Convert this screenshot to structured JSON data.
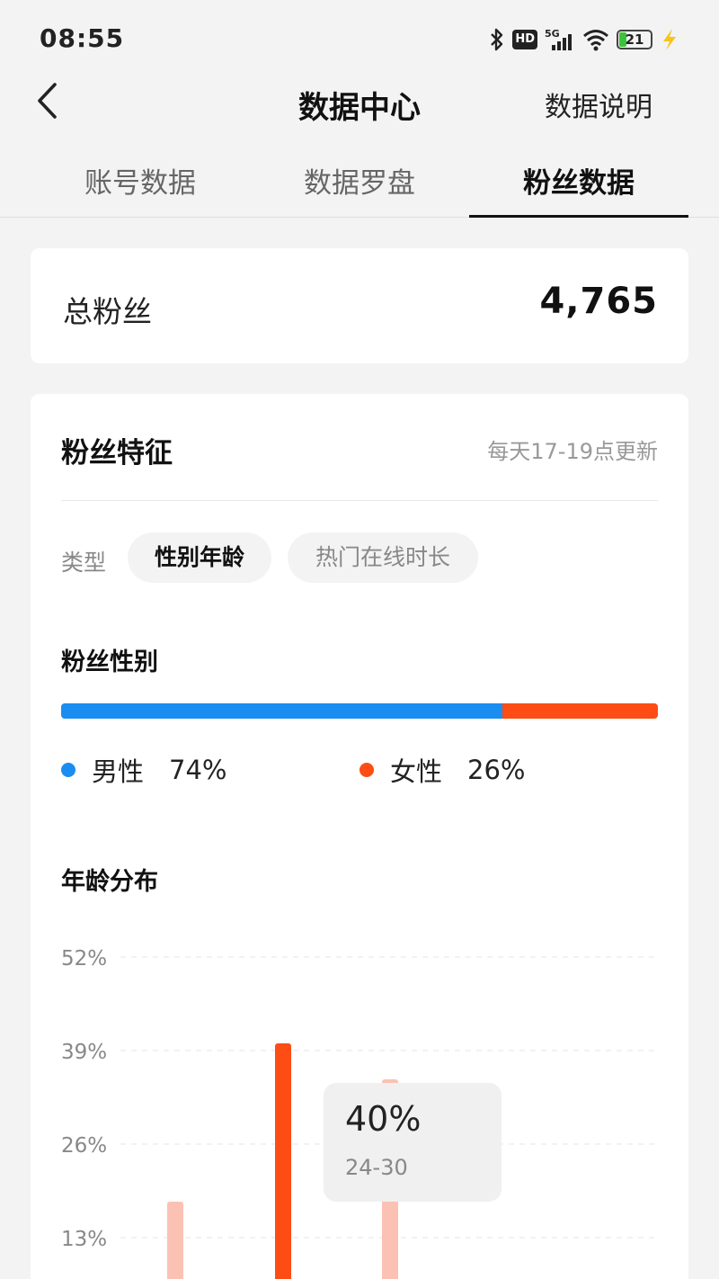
{
  "status_bar": {
    "time": "08:55",
    "icons": [
      "bluetooth-icon",
      "hd-icon",
      "signal-5g-icon",
      "wifi-icon",
      "battery-icon",
      "charging-icon"
    ],
    "hd_label": "HD",
    "network_label": "5G",
    "battery_level": "21"
  },
  "header": {
    "title": "数据中心",
    "action": "数据说明"
  },
  "tabs": [
    {
      "label": "账号数据",
      "active": false
    },
    {
      "label": "数据罗盘",
      "active": false
    },
    {
      "label": "粉丝数据",
      "active": true
    }
  ],
  "total": {
    "label": "总粉丝",
    "value": "4,765"
  },
  "fans": {
    "title": "粉丝特征",
    "update_note": "每天17-19点更新",
    "type_label": "类型",
    "chips": [
      {
        "label": "性别年龄",
        "active": true
      },
      {
        "label": "热门在线时长",
        "active": false
      }
    ],
    "gender": {
      "title": "粉丝性别",
      "male_label": "男性",
      "male_pct": "74%",
      "male_value": 74,
      "female_label": "女性",
      "female_pct": "26%",
      "female_value": 26,
      "male_color": "#1a8ef0",
      "female_color": "#fd4d14"
    },
    "age": {
      "title": "年龄分布",
      "tooltip": {
        "value": "40%",
        "label": "24-30"
      }
    }
  },
  "chart_data": {
    "type": "bar",
    "title": "年龄分布",
    "y_ticks": [
      "52%",
      "39%",
      "26%",
      "13%"
    ],
    "y_tick_values": [
      52,
      39,
      26,
      13
    ],
    "ylim": [
      0,
      52
    ],
    "grid": true,
    "values": [
      18,
      40,
      35
    ],
    "highlight_index": 1,
    "colors": {
      "normal": "#fbc1b3",
      "highlight": "#fd4d14"
    }
  }
}
